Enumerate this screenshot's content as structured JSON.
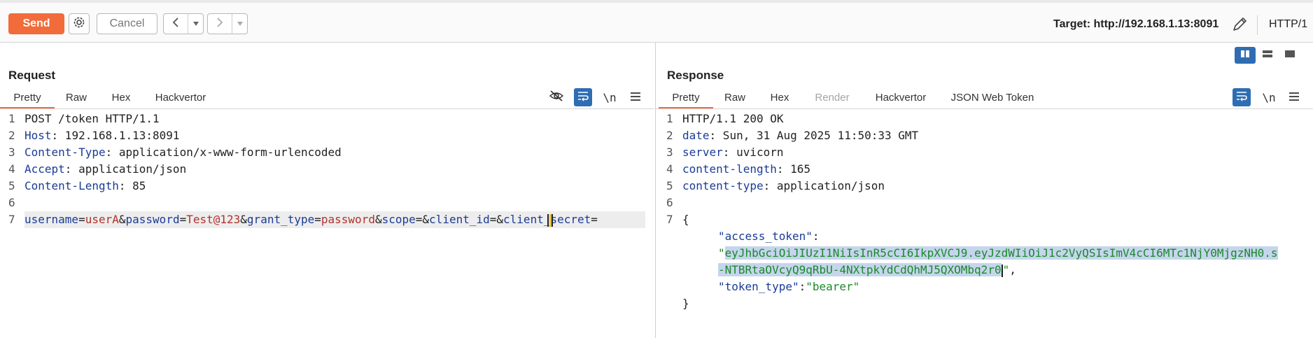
{
  "toolbar": {
    "send_label": "Send",
    "cancel_label": "Cancel",
    "back_icon": "chevron-left-icon",
    "forward_icon": "chevron-right-icon",
    "target_text": "Target: http://192.168.1.13:8091",
    "http_version": "HTTP/1"
  },
  "colors": {
    "accent": "#f26b3a",
    "active_blue": "#2f6db3",
    "key_blue": "#1b3c96",
    "param_red": "#b1322a",
    "json_green": "#1a8a2a"
  },
  "request": {
    "title": "Request",
    "tabs": [
      "Pretty",
      "Raw",
      "Hex",
      "Hackvertor"
    ],
    "newline_toggle": "\\n",
    "line_numbers": [
      "1",
      "2",
      "3",
      "4",
      "5",
      "6",
      "7"
    ],
    "request_line": "POST /token HTTP/1.1",
    "headers": [
      {
        "name": "Host",
        "value": " 192.168.1.13:8091"
      },
      {
        "name": "Content-Type",
        "value": " application/x-www-form-urlencoded"
      },
      {
        "name": "Accept",
        "value": " application/json"
      },
      {
        "name": "Content-Length",
        "value": " 85"
      }
    ],
    "body_params": [
      {
        "key": "username",
        "value": "userA"
      },
      {
        "key": "password",
        "value": "Test@123"
      },
      {
        "key": "grant_type",
        "value": "password"
      },
      {
        "key": "scope",
        "value": ""
      },
      {
        "key": "client_id",
        "value": ""
      },
      {
        "key": "client_secret",
        "value": ""
      }
    ]
  },
  "response": {
    "title": "Response",
    "tabs": [
      "Pretty",
      "Raw",
      "Hex",
      "Render",
      "Hackvertor",
      "JSON Web Token"
    ],
    "newline_toggle": "\\n",
    "line_numbers": [
      "1",
      "2",
      "3",
      "4",
      "5",
      "6",
      "7"
    ],
    "status_line": "HTTP/1.1 200 OK",
    "headers": [
      {
        "name": "date",
        "value": " Sun, 31 Aug 2025 11:50:33 GMT"
      },
      {
        "name": "server",
        "value": " uvicorn"
      },
      {
        "name": "content-length",
        "value": " 165"
      },
      {
        "name": "content-type",
        "value": " application/json"
      }
    ],
    "json": {
      "open_brace": "{",
      "close_brace": "}",
      "access_token_key": "\"access_token\"",
      "access_token_line1": "eyJhbGciOiJIUzI1NiIsInR5cCI6IkpXVCJ9.eyJzdWIiOiJ1c2VyQSIsImV4cCI6MTc1NjY0MjgzNH0.s",
      "access_token_line2": "-NTBRtaOVcyQ9qRbU-4NXtpkYdCdQhMJ5QXOMbq2r0",
      "token_type_key": "\"token_type\"",
      "token_type_value": "\"bearer\""
    }
  }
}
